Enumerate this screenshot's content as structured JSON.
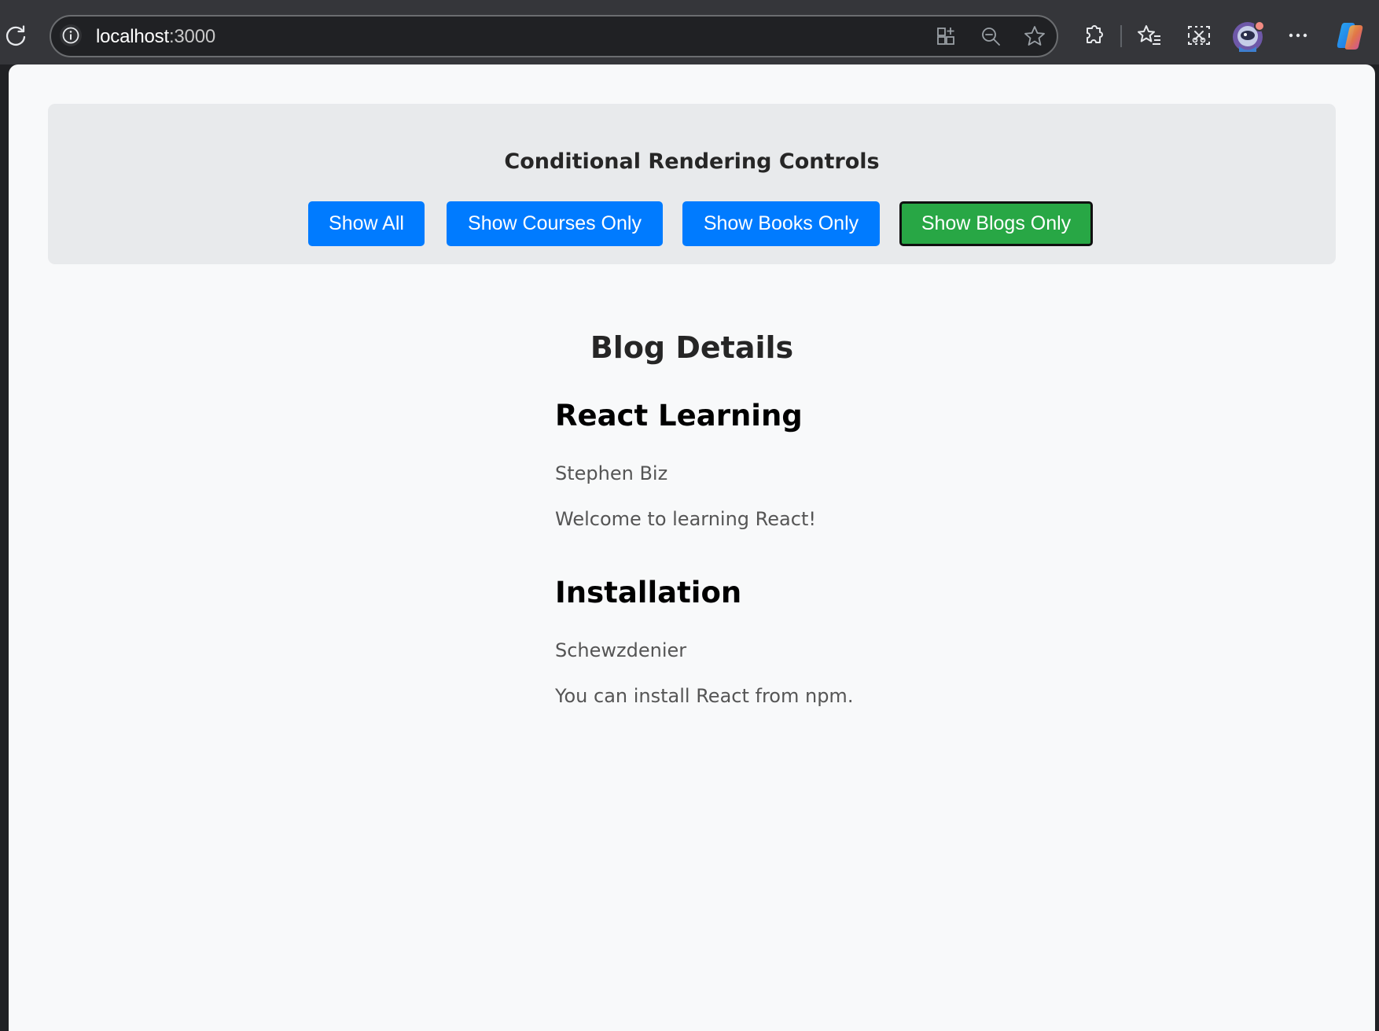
{
  "browser": {
    "url_host": "localhost",
    "url_port": ":3000"
  },
  "controls": {
    "title": "Conditional Rendering Controls",
    "buttons": [
      {
        "label": "Show All",
        "active": false
      },
      {
        "label": "Show Courses Only",
        "active": false
      },
      {
        "label": "Show Books Only",
        "active": false
      },
      {
        "label": "Show Blogs Only",
        "active": true
      }
    ]
  },
  "section": {
    "title": "Blog Details"
  },
  "blogs": [
    {
      "title": "React Learning",
      "author": "Stephen Biz",
      "content": "Welcome to learning React!"
    },
    {
      "title": "Installation",
      "author": "Schewzdenier",
      "content": "You can install React from npm."
    }
  ],
  "colors": {
    "primary_button": "#007bff",
    "active_button": "#28a745",
    "controls_background": "#e8eaec",
    "page_background": "#f8f9fa"
  }
}
